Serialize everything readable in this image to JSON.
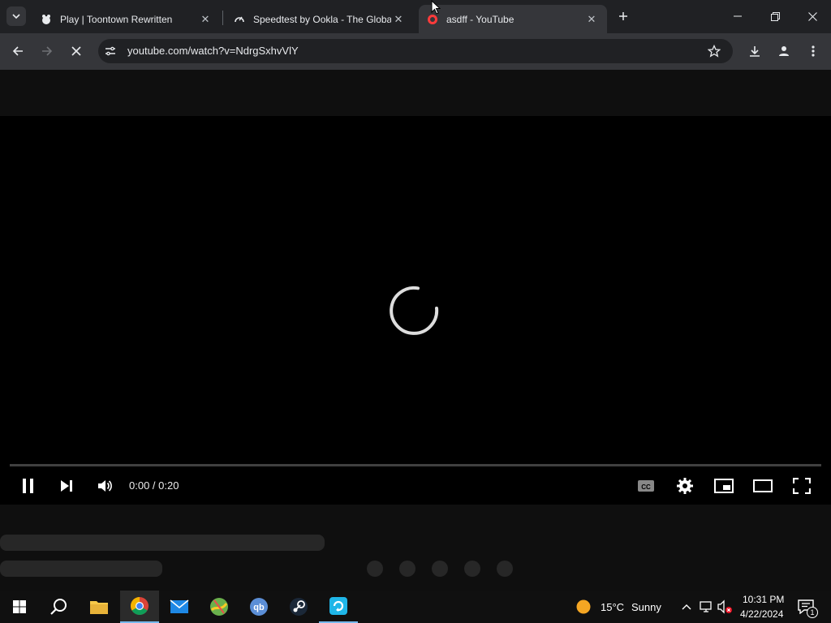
{
  "browser": {
    "tabs": [
      {
        "title": "Play | Toontown Rewritten",
        "icon": "toontown-icon"
      },
      {
        "title": "Speedtest by Ookla - The Global Broadband Speed Test",
        "icon": "speedtest-icon"
      },
      {
        "title": "asdff - YouTube",
        "icon": "youtube-icon",
        "active": true
      }
    ],
    "url": "youtube.com/watch?v=NdrgSxhvVlY"
  },
  "player": {
    "time": "0:00 / 0:20",
    "progress": 0,
    "state": "loading"
  },
  "taskbar": {
    "apps": [
      "file-explorer",
      "chrome",
      "mail",
      "maps",
      "qbittorrent",
      "steam",
      "sync"
    ],
    "weather": {
      "temp": "15°C",
      "condition": "Sunny"
    },
    "clock": {
      "time": "10:31 PM",
      "date": "4/22/2024"
    },
    "notification_count": "1"
  },
  "colors": {
    "taskbar_accent": "#76b9ed",
    "skeleton": "#272727"
  }
}
